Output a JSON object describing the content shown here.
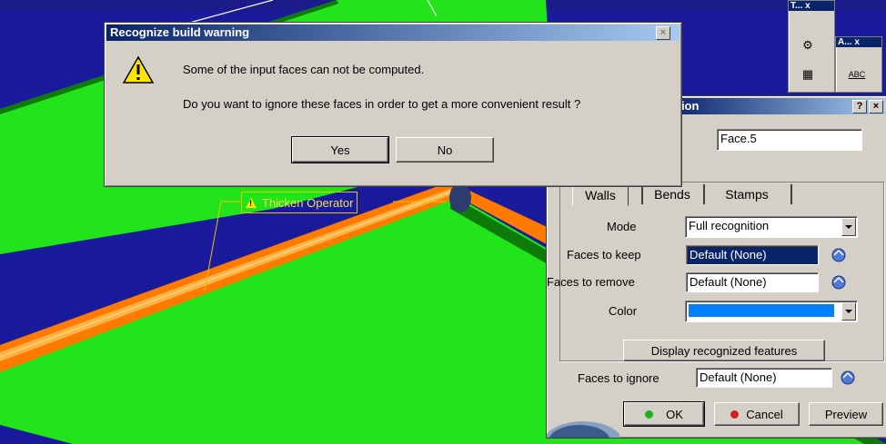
{
  "warning_dialog": {
    "title": "Recognize build warning",
    "line1": "Some of the input faces can not be computed.",
    "line2": "Do you want to ignore these faces in order to get a more convenient result ?",
    "yes_label": "Yes",
    "no_label": "No",
    "close_glyph": "×",
    "icon": "warning-icon"
  },
  "annotation": {
    "text": "Thicken Operator",
    "icon": "warning-icon"
  },
  "toolbars": {
    "small_title_1": "T... x",
    "small_title_2": "A... x",
    "abc_label": "ABC"
  },
  "recognition_panel": {
    "title_fragment": "ition",
    "help_glyph": "?",
    "close_glyph": "×",
    "face_value": "Face.5",
    "tabs": [
      {
        "label": "Walls"
      },
      {
        "label": "Bends"
      },
      {
        "label": "Stamps"
      }
    ],
    "mode_label": "Mode",
    "mode_value": "Full recognition",
    "faces_to_keep_label": "Faces to keep",
    "faces_to_keep_value": "Default (None)",
    "faces_to_remove_label": "Faces to remove",
    "faces_to_remove_value": "Default (None)",
    "color_label": "Color",
    "color_value": "#0080ff",
    "display_button": "Display recognized features",
    "faces_to_ignore_label": "Faces to ignore",
    "faces_to_ignore_value": "Default (None)",
    "ok_label": "OK",
    "cancel_label": "Cancel",
    "preview_label": "Preview"
  },
  "colors": {
    "plate_green": "#22e41a",
    "thicken_orange": "#ff7a00",
    "viewport_blue": "#1a1a9c",
    "dialog_grey": "#d4d0c8",
    "title_blue": "#0a246a"
  }
}
